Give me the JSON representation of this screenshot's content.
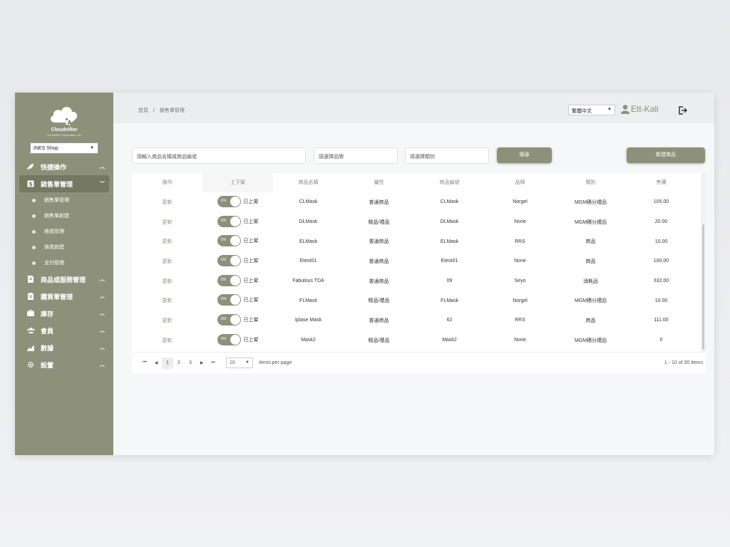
{
  "brand": {
    "name": "Cloudnifier",
    "sub": "Cloudnifier Corporation Ltd."
  },
  "shop_select": {
    "value": "INES Shop"
  },
  "nav": {
    "quick": "快捷操作",
    "sales": "銷售單管理",
    "sales_sub": [
      "銷售單管理",
      "銷售單創建",
      "換貨管理",
      "換貨創建",
      "支付管理"
    ],
    "products": "商品或服務管理",
    "purchase": "購貨單管理",
    "inventory": "庫存",
    "members": "會員",
    "data": "數據",
    "settings": "設置"
  },
  "breadcrumb": {
    "home": "首頁",
    "sep": "/",
    "current": "銷售單管理"
  },
  "lang_select": {
    "value": "繁體中文"
  },
  "user": {
    "name": "Ett-Kali"
  },
  "filters": {
    "search_placeholder": "請輸入商品名稱或商品編號",
    "brand_placeholder": "請選擇品牌",
    "category_placeholder": "請選擇類別",
    "search_btn": "搜尋",
    "new_btn": "新建商品"
  },
  "table": {
    "columns": [
      "操作",
      "上下架",
      "商品名稱",
      "屬性",
      "商品編號",
      "品牌",
      "類別",
      "售價"
    ],
    "toggle_on": "ON",
    "rows": [
      {
        "op": "更新",
        "status": "已上架",
        "name": "CLMask",
        "attr": "普通商品",
        "code": "CLMask",
        "brand": "Norgel",
        "cat": "MGM積分禮品",
        "price": "105.00"
      },
      {
        "op": "更新",
        "status": "已上架",
        "name": "DLMask",
        "attr": "贈品/禮品",
        "code": "DLMask",
        "brand": "None",
        "cat": "MGM積分禮品",
        "price": "20.00"
      },
      {
        "op": "更新",
        "status": "已上架",
        "name": "ELMask",
        "attr": "普通商品",
        "code": "ELMask",
        "brand": "RRS",
        "cat": "商品",
        "price": "10.00"
      },
      {
        "op": "更新",
        "status": "已上架",
        "name": "Etest01",
        "attr": "普通商品",
        "code": "Etest01",
        "brand": "None",
        "cat": "商品",
        "price": "100.00"
      },
      {
        "op": "更新",
        "status": "已上架",
        "name": "Fabulous TDA",
        "attr": "普通商品",
        "code": "09",
        "brand": "Seyo",
        "cat": "消耗品",
        "price": "332.00"
      },
      {
        "op": "更新",
        "status": "已上架",
        "name": "FLMask",
        "attr": "贈品/禮品",
        "code": "FLMask",
        "brand": "Norgel",
        "cat": "MGM積分禮品",
        "price": "10.00"
      },
      {
        "op": "更新",
        "status": "已上架",
        "name": "Iplase Mask",
        "attr": "普通商品",
        "code": "62",
        "brand": "RRS",
        "cat": "商品",
        "price": "111.00"
      },
      {
        "op": "更新",
        "status": "已上架",
        "name": "Mask2",
        "attr": "贈品/禮品",
        "code": "Mask2",
        "brand": "None",
        "cat": "MGM積分禮品",
        "price": "0"
      }
    ]
  },
  "pager": {
    "pages": [
      "1",
      "2",
      "3"
    ],
    "per_page": "10",
    "per_page_label": "items per page",
    "total": "1 - 10 of 30 items"
  },
  "colors": {
    "accent": "#8e9179",
    "sidebar_active": "#767962"
  }
}
